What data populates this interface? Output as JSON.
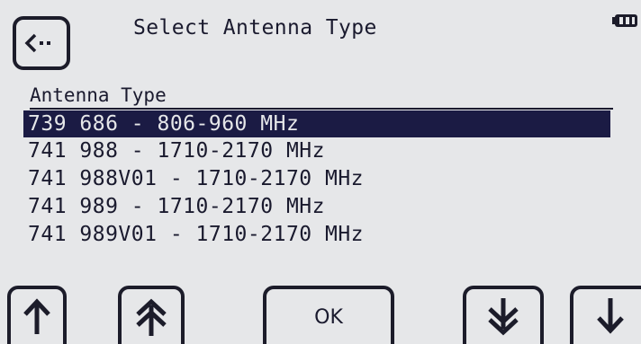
{
  "header": {
    "title": "Select Antenna Type",
    "back_icon": "back-arrow-icon",
    "battery_icon": "battery-icon"
  },
  "list": {
    "column_header": "Antenna Type",
    "items": [
      {
        "label": "739 686 - 806-960 MHz",
        "selected": true
      },
      {
        "label": "741 988 - 1710-2170 MHz",
        "selected": false
      },
      {
        "label": "741 988V01 - 1710-2170 MHz",
        "selected": false
      },
      {
        "label": "741 989 - 1710-2170 MHz",
        "selected": false
      },
      {
        "label": "741 989V01 - 1710-2170 MHz",
        "selected": false
      }
    ]
  },
  "buttons": {
    "up_icon": "arrow-up-icon",
    "page_up_icon": "double-arrow-up-icon",
    "ok_label": "OK",
    "page_down_icon": "double-arrow-down-icon",
    "down_icon": "arrow-down-icon"
  },
  "colors": {
    "background": "#e6e7e9",
    "foreground": "#1a1a2e",
    "selection": "#1b1b44"
  }
}
